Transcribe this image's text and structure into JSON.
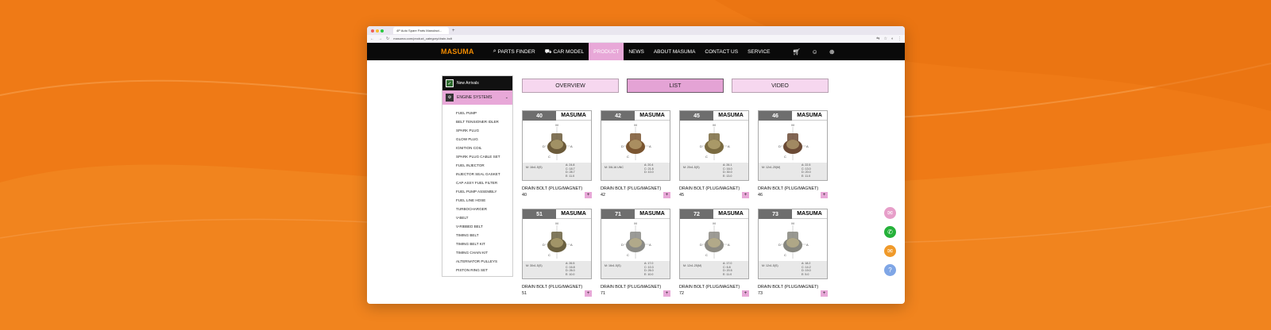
{
  "browser": {
    "tab_title": "4P Auto Spare Parts Manufact...",
    "url": "masuma.com/product_category/drain-bolt"
  },
  "nav": {
    "logo": "MASUMA",
    "items": [
      {
        "label": "PARTS FINDER",
        "icon": "search-icon",
        "active": false
      },
      {
        "label": "CAR MODEL",
        "icon": "car-icon",
        "active": false
      },
      {
        "label": "PRODUCT",
        "icon": "",
        "active": true
      },
      {
        "label": "NEWS",
        "icon": "",
        "active": false
      },
      {
        "label": "ABOUT MASUMA",
        "icon": "",
        "active": false
      },
      {
        "label": "CONTACT US",
        "icon": "",
        "active": false
      },
      {
        "label": "SERVICE",
        "icon": "",
        "active": false
      }
    ]
  },
  "sidebar": {
    "new_arrivals": "New Arrivals",
    "category": "ENGINE SYSTEMS",
    "items": [
      "FUEL PUMP",
      "BELT TENSIONER IDLER",
      "SPARK PLUG",
      "GLOW PLUG",
      "IGNITION COIL",
      "SPARK PLUG CABLE SET",
      "FUEL INJECTOR",
      "INJECTOR SEAL GASKET",
      "CAP ASSY FUEL FILTER",
      "FUEL PUMP ASSEMBLY",
      "FUEL LINE HOSE",
      "TURBOCHARGER",
      "V-BELT",
      "V-RIBBED BELT",
      "TIMING BELT",
      "TIMING BELT KIT",
      "TIMING CHAIN KIT",
      "ALTERNATOR PULLEYS",
      "PISTON RING SET",
      "VALVE COVER GASKET"
    ]
  },
  "view_tabs": {
    "overview": "OVERVIEW",
    "list": "LIST",
    "video": "VIDEO"
  },
  "brand": "MASUMA",
  "products": [
    {
      "num": "40",
      "name": "DRAIN BOLT (PLUG/MAGNET)",
      "code": "40",
      "spec_l": "M: 16x1.5(S)",
      "spec_r": [
        "A: 24.8",
        "C: 18.7",
        "D: 28.7",
        "E: 11.0"
      ],
      "shade": "#6b5a3a"
    },
    {
      "num": "42",
      "name": "DRAIN BOLT (PLUG/MAGNET)",
      "code": "42",
      "spec_l": "M: 3/8-16 UNC",
      "spec_r": [
        "A: 20.4",
        "C: 21.8",
        "D: 10.0"
      ],
      "shade": "#7a5530"
    },
    {
      "num": "45",
      "name": "DRAIN BOLT (PLUG/MAGNET)",
      "code": "45",
      "spec_l": "M: 20x1.5(S)",
      "spec_r": [
        "A: 26.1",
        "C: 16.0",
        "D: 30.0",
        "E: 13.0"
      ],
      "shade": "#7a6a40"
    },
    {
      "num": "46",
      "name": "DRAIN BOLT (PLUG/MAGNET)",
      "code": "46",
      "spec_l": "M: 12x1.25(M)",
      "spec_r": [
        "A: 22.5",
        "C: 13.0",
        "D: 20.0",
        "E: 11.0"
      ],
      "shade": "#6b4a35"
    },
    {
      "num": "51",
      "name": "DRAIN BOLT (PLUG/MAGNET)",
      "code": "51",
      "spec_l": "M: 30x1.5(S)",
      "spec_r": [
        "A: 26.5",
        "C: 16.8",
        "D: 26.0",
        "E: 10.0"
      ],
      "shade": "#6a6040"
    },
    {
      "num": "71",
      "name": "DRAIN BOLT (PLUG/MAGNET)",
      "code": "71",
      "spec_l": "M: 16x1.5(S)",
      "spec_r": [
        "A: 17.0",
        "C: 10.3",
        "D: 26.0",
        "E: 10.0"
      ],
      "shade": "#8a8a85"
    },
    {
      "num": "72",
      "name": "DRAIN BOLT (PLUG/MAGNET)",
      "code": "72",
      "spec_l": "M: 12x1.25(M)",
      "spec_r": [
        "A: 17.0",
        "C: 6.8",
        "D: 20.5",
        "E: 11.0"
      ],
      "shade": "#8c8a82"
    },
    {
      "num": "73",
      "name": "DRAIN BOLT (PLUG/MAGNET)",
      "code": "73",
      "spec_l": "M: 12x1.5(S)",
      "spec_r": [
        "A: 18.2",
        "C: 14.2",
        "D: 19.0",
        "E: 5.0"
      ],
      "shade": "#86867e"
    }
  ],
  "colors": {
    "accent": "#e8a8d8",
    "nav_bg": "#0a0a0a",
    "logo": "#f08a00",
    "page_bg": "#ef7a16"
  },
  "floating": [
    {
      "icon": "chat-icon",
      "color": "#e79ec9"
    },
    {
      "icon": "whatsapp-icon",
      "color": "#25b13a"
    },
    {
      "icon": "email-icon",
      "color": "#f09a2a"
    },
    {
      "icon": "support-icon",
      "color": "#7fa6e6"
    }
  ]
}
